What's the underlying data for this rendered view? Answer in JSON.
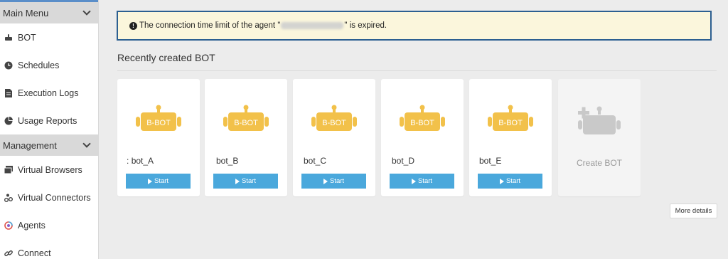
{
  "sidebar": {
    "main_menu_label": "Main Menu",
    "management_label": "Management",
    "main_items": [
      {
        "label": "BOT",
        "icon": "robot-icon"
      },
      {
        "label": "Schedules",
        "icon": "clock-icon"
      },
      {
        "label": "Execution Logs",
        "icon": "document-icon"
      },
      {
        "label": "Usage Reports",
        "icon": "pie-chart-icon"
      }
    ],
    "management_items": [
      {
        "label": "Virtual Browsers",
        "icon": "browser-icon"
      },
      {
        "label": "Virtual Connectors",
        "icon": "connector-icon"
      },
      {
        "label": "Agents",
        "icon": "agent-icon"
      },
      {
        "label": "Connect",
        "icon": "link-icon"
      }
    ]
  },
  "alert": {
    "text_before": "The connection time limit of the agent \"",
    "text_after": "\" is expired."
  },
  "recent": {
    "title": "Recently created BOT",
    "badge": "B-BOT",
    "start_label": "Start",
    "bots": [
      {
        "name": "bot_A",
        "prefix": ":"
      },
      {
        "name": "bot_B",
        "prefix": ""
      },
      {
        "name": "bot_C",
        "prefix": ""
      },
      {
        "name": "bot_D",
        "prefix": ""
      },
      {
        "name": "bot_E",
        "prefix": ""
      }
    ],
    "create_label": "Create BOT",
    "more_label": "More details"
  },
  "colors": {
    "accent": "#4aa8dc",
    "robot": "#f2c14a",
    "alert_bg": "#fbf6dc",
    "alert_border": "#2c5f91"
  }
}
